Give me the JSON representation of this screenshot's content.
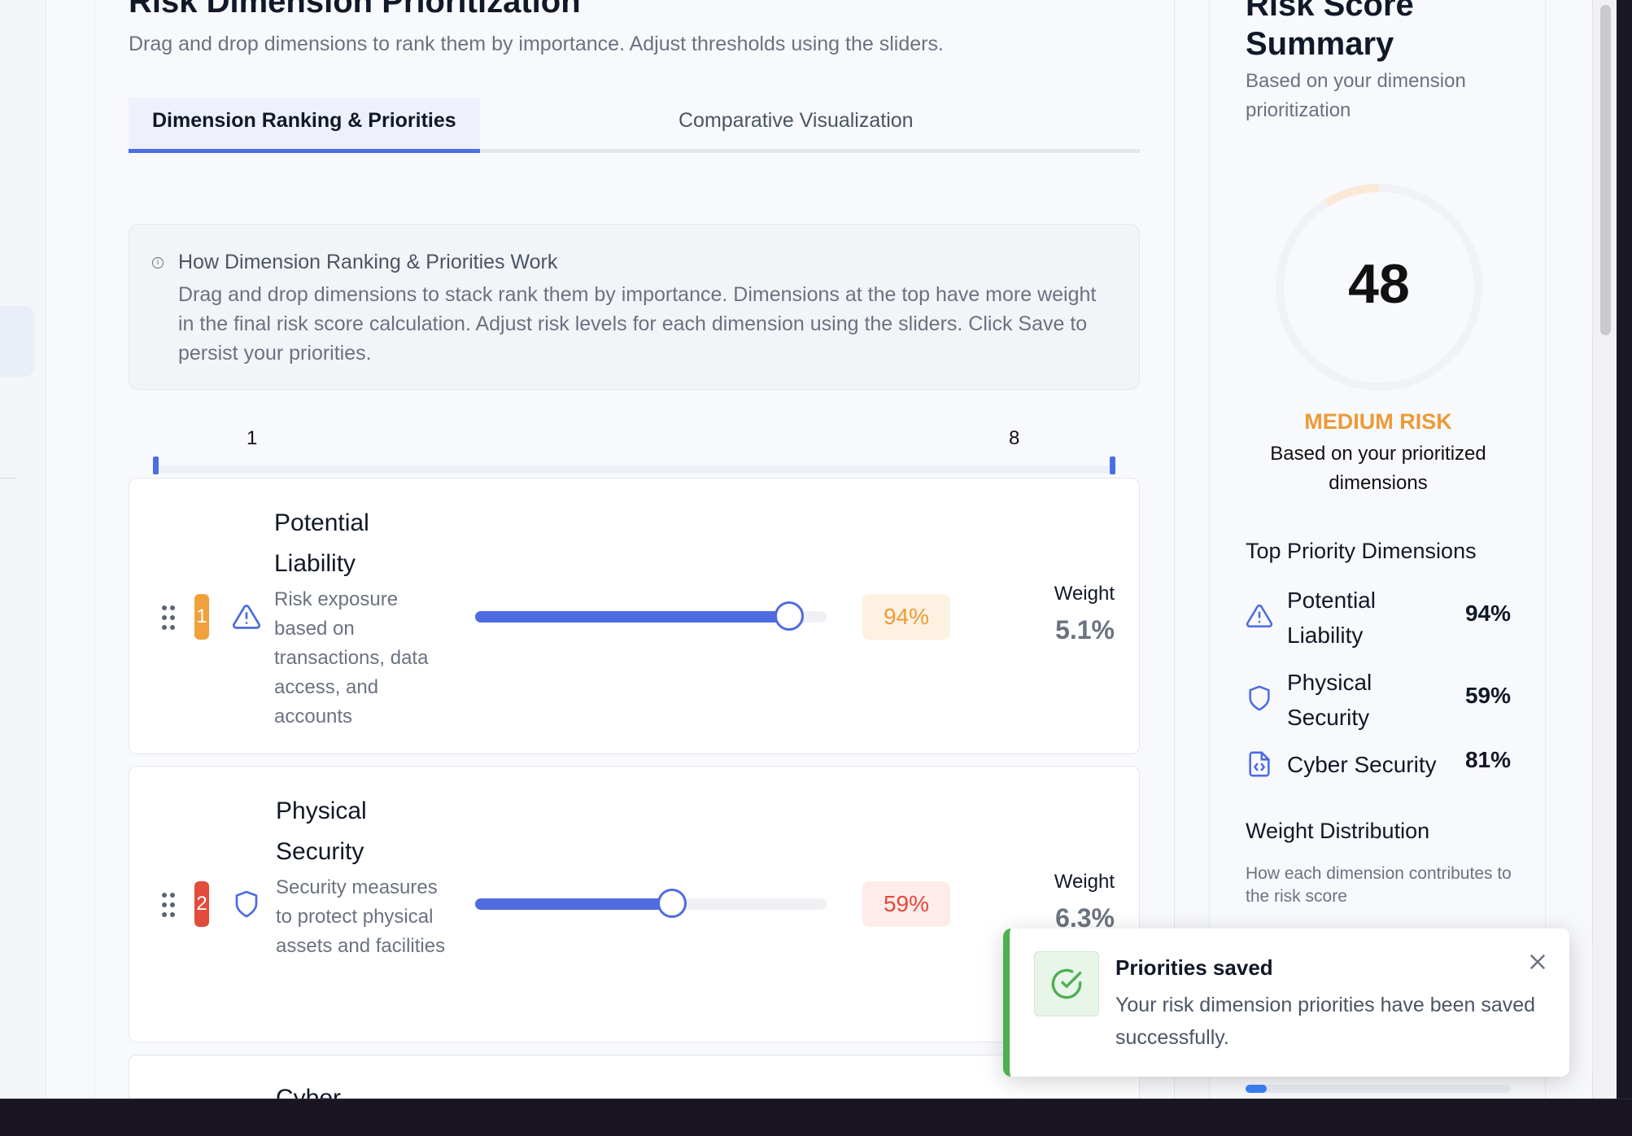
{
  "page": {
    "title": "Risk Dimension Prioritization",
    "subtitle": "Drag and drop dimensions to rank them by importance. Adjust thresholds using the sliders."
  },
  "tabs": [
    {
      "label": "Dimension Ranking & Priorities",
      "active": true
    },
    {
      "label": "Comparative Visualization",
      "active": false
    }
  ],
  "info": {
    "icon": "info-icon",
    "title": "How Dimension Ranking & Priorities Work",
    "body": "Drag and drop dimensions to stack rank them by importance. Dimensions at the top have more weight in the final risk score calculation. Adjust risk levels for each dimension using the sliders. Click Save to persist your priorities."
  },
  "rank_scale": {
    "min": "1",
    "max": "8"
  },
  "dimensions": [
    {
      "rank": "1",
      "rank_color": "#f0a13b",
      "icon": "alert-triangle-icon",
      "name": "Potential Liability",
      "description": "Risk exposure based on transactions, data access, and accounts",
      "level": 0.94,
      "percent": "94%",
      "pill_bg": "#fdf1e2",
      "pill_color": "#ee9a37",
      "weight_label": "Weight",
      "weight": "5.1%"
    },
    {
      "rank": "2",
      "rank_color": "#e24c3b",
      "icon": "shield-icon",
      "name": "Physical Security",
      "description": "Security measures to protect physical assets and facilities",
      "level": 0.59,
      "percent": "59%",
      "pill_bg": "#fdecea",
      "pill_color": "#e5483b",
      "weight_label": "Weight",
      "weight": "6.3%"
    },
    {
      "name": "Cyber"
    }
  ],
  "summary": {
    "title": "Risk Score Summary",
    "subtitle": "Based on your dimension prioritization",
    "score": "48",
    "risk_level": "MEDIUM RISK",
    "risk_level_color": "#ed9a36",
    "risk_note": "Based on your prioritized dimensions",
    "top_heading": "Top Priority Dimensions",
    "top": [
      {
        "icon": "alert-triangle-icon",
        "name": "Potential Liability",
        "value": "94%"
      },
      {
        "icon": "shield-icon",
        "name": "Physical Security",
        "value": "59%"
      },
      {
        "icon": "file-code-icon",
        "name": "Cyber Security",
        "value": "81%"
      }
    ],
    "weight_heading": "Weight Distribution",
    "weight_sub": "How each dimension contributes to the risk score"
  },
  "toast": {
    "icon": "check-circle-icon",
    "title": "Priorities saved",
    "message": "Your risk dimension priorities have been saved successfully.",
    "close_icon": "close-icon",
    "accent": "#4caf50"
  },
  "colors": {
    "accent": "#4e6ce0"
  }
}
